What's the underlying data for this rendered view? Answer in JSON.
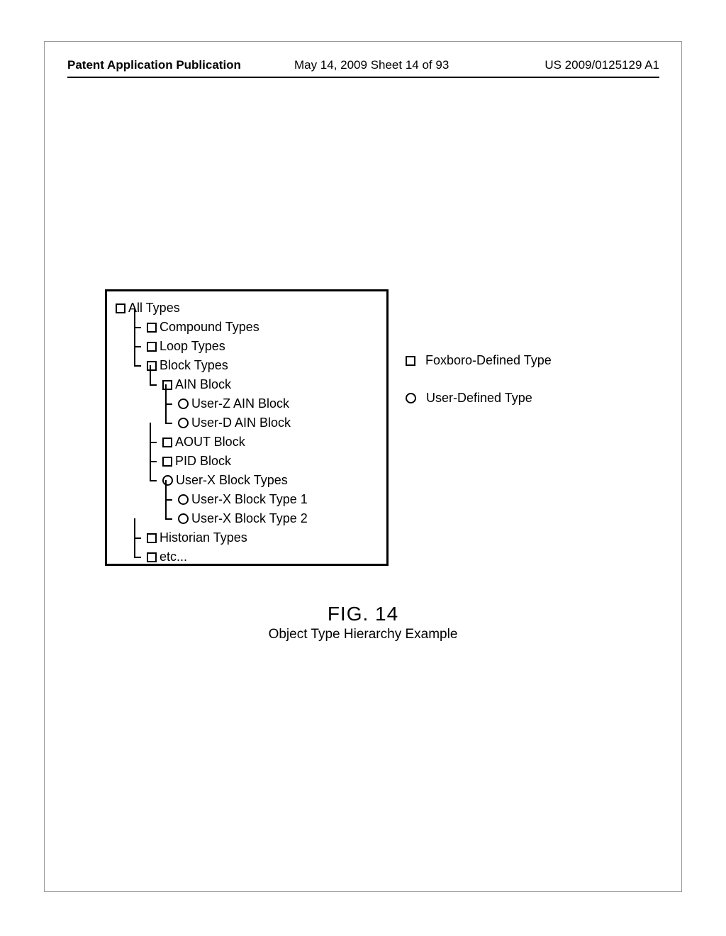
{
  "header": {
    "left": "Patent Application Publication",
    "mid": "May 14, 2009  Sheet 14 of 93",
    "right": "US 2009/0125129 A1"
  },
  "tree": {
    "root": "All Types",
    "items": [
      {
        "label": "Compound Types",
        "icon": "square"
      },
      {
        "label": "Loop Types",
        "icon": "square"
      },
      {
        "label": "Block Types",
        "icon": "square"
      },
      {
        "label": "AIN Block",
        "icon": "square"
      },
      {
        "label": "User-Z AIN Block",
        "icon": "circle"
      },
      {
        "label": "User-D AIN Block",
        "icon": "circle"
      },
      {
        "label": "AOUT Block",
        "icon": "square"
      },
      {
        "label": "PID Block",
        "icon": "square"
      },
      {
        "label": "User-X Block Types",
        "icon": "circle"
      },
      {
        "label": "User-X Block Type 1",
        "icon": "circle"
      },
      {
        "label": "User-X Block Type 2",
        "icon": "circle"
      },
      {
        "label": "Historian Types",
        "icon": "square"
      },
      {
        "label": "etc...",
        "icon": "square"
      }
    ]
  },
  "legend": {
    "foxboro": "Foxboro-Defined Type",
    "user": "User-Defined Type"
  },
  "caption": {
    "fig": "FIG. 14",
    "title": "Object Type Hierarchy Example"
  }
}
